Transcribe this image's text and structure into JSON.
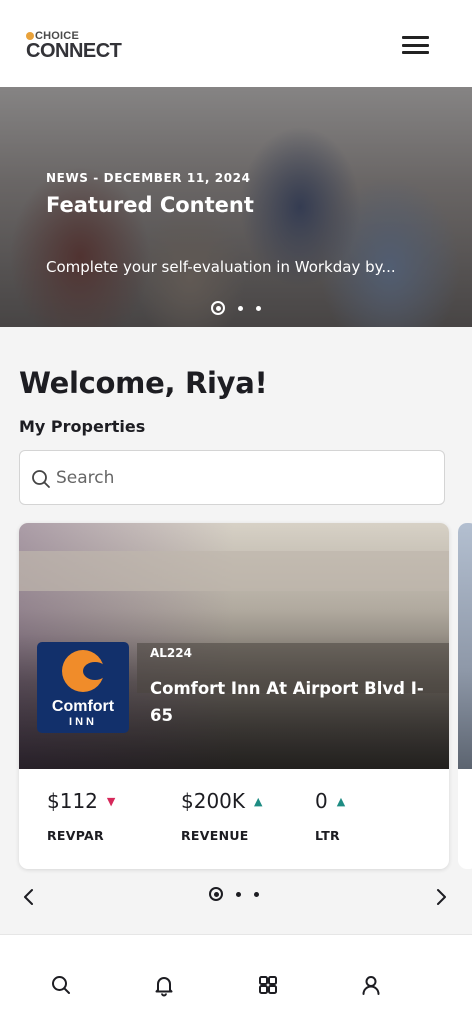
{
  "header": {
    "brand_small": "CHOICE",
    "brand_big": "CONNECT",
    "menu_icon": "hamburger-menu-icon"
  },
  "hero": {
    "tag": "NEWS - DECEMBER 11, 2024",
    "title": "Featured Content",
    "subtitle": "Complete your self-evaluation in Workday by...",
    "slide_count": 3,
    "active_slide": 1
  },
  "main": {
    "welcome": "Welcome, Riya!",
    "section_title": "My Properties",
    "search": {
      "placeholder": "Search",
      "value": "",
      "icon": "search-icon"
    }
  },
  "property_card": {
    "logo_brand": "Comfort",
    "logo_sub": "INN",
    "code": "AL224",
    "name": "Comfort Inn At Airport Blvd I-65",
    "metrics": [
      {
        "value": "$112",
        "trend": "down",
        "label": "REVPAR",
        "trend_color": "#d6285a"
      },
      {
        "value": "$200K",
        "trend": "up",
        "label": "REVENUE",
        "trend_color": "#1e8c83"
      },
      {
        "value": "0",
        "trend": "up",
        "label": "LTR",
        "trend_color": "#1e8c83"
      }
    ],
    "card_count": 3,
    "active_card": 1
  },
  "bottom_nav": {
    "items": [
      {
        "icon": "search-icon"
      },
      {
        "icon": "bell-icon"
      },
      {
        "icon": "grid-icon"
      },
      {
        "icon": "user-icon"
      }
    ]
  },
  "colors": {
    "accent_orange": "#f08c2a",
    "brand_navy": "#12306b",
    "trend_down": "#d6285a",
    "trend_up": "#1e8c83"
  }
}
